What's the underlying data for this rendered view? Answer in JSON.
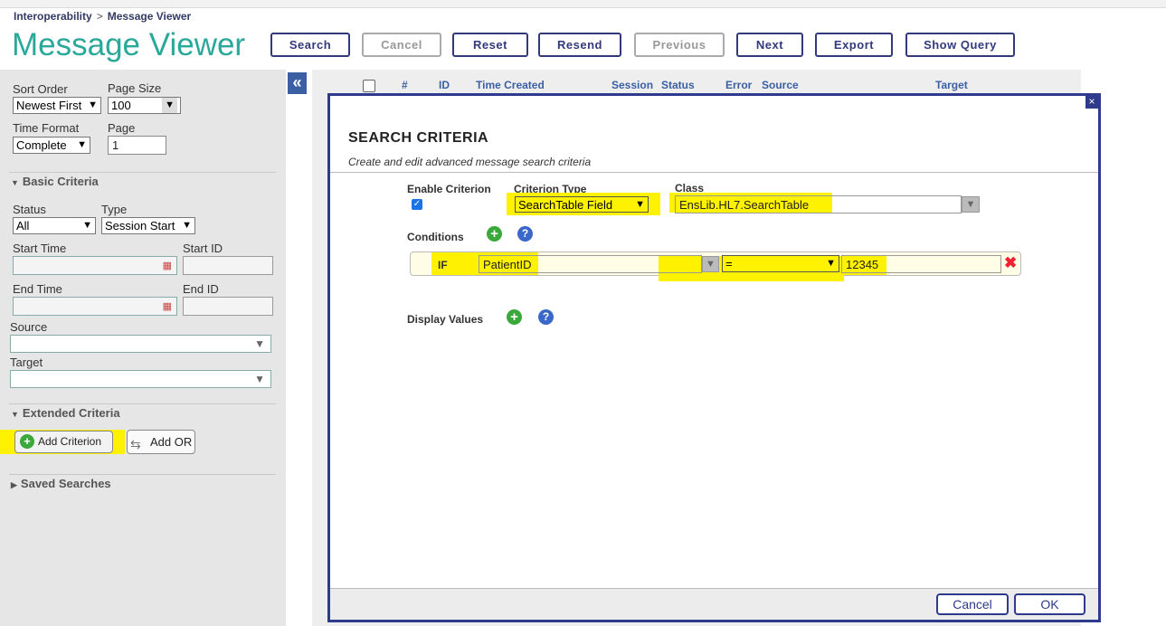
{
  "breadcrumb": {
    "root": "Interoperability",
    "separator": ">",
    "current": "Message Viewer"
  },
  "page_title": "Message Viewer",
  "toolbar": {
    "search": "Search",
    "cancel": "Cancel",
    "reset": "Reset",
    "resend": "Resend",
    "previous": "Previous",
    "next": "Next",
    "export": "Export",
    "show_query": "Show Query"
  },
  "sidebar": {
    "sort_order_label": "Sort Order",
    "sort_order_value": "Newest First",
    "page_size_label": "Page Size",
    "page_size_value": "100",
    "time_format_label": "Time Format",
    "time_format_value": "Complete",
    "page_label": "Page",
    "page_value": "1",
    "basic_criteria": "Basic Criteria",
    "status_label": "Status",
    "status_value": "All",
    "type_label": "Type",
    "type_value": "Session Start",
    "start_time_label": "Start Time",
    "start_id_label": "Start ID",
    "end_time_label": "End Time",
    "end_id_label": "End ID",
    "source_label": "Source",
    "target_label": "Target",
    "extended_criteria": "Extended Criteria",
    "add_criterion": "Add Criterion",
    "add_or": "Add OR",
    "saved_searches": "Saved Searches",
    "collapse_glyph": "«"
  },
  "grid_headers": [
    "#",
    "ID",
    "Time Created",
    "Session",
    "Status",
    "Error",
    "Source",
    "Target"
  ],
  "modal": {
    "close_glyph": "×",
    "title": "SEARCH CRITERIA",
    "subtitle": "Create and edit advanced message search criteria",
    "enable_label": "Enable Criterion",
    "criterion_type_label": "Criterion Type",
    "criterion_type_value": "SearchTable Field",
    "class_label": "Class",
    "class_value": "EnsLib.HL7.SearchTable",
    "conditions_label": "Conditions",
    "if_label": "IF",
    "field_value": "PatientID",
    "operator_value": "=",
    "condition_value": "12345",
    "display_values_label": "Display Values",
    "cancel": "Cancel",
    "ok": "OK"
  },
  "colors": {
    "title_teal": "#2aa89a",
    "nav_blue": "#333a7c",
    "highlight": "#fff200"
  }
}
